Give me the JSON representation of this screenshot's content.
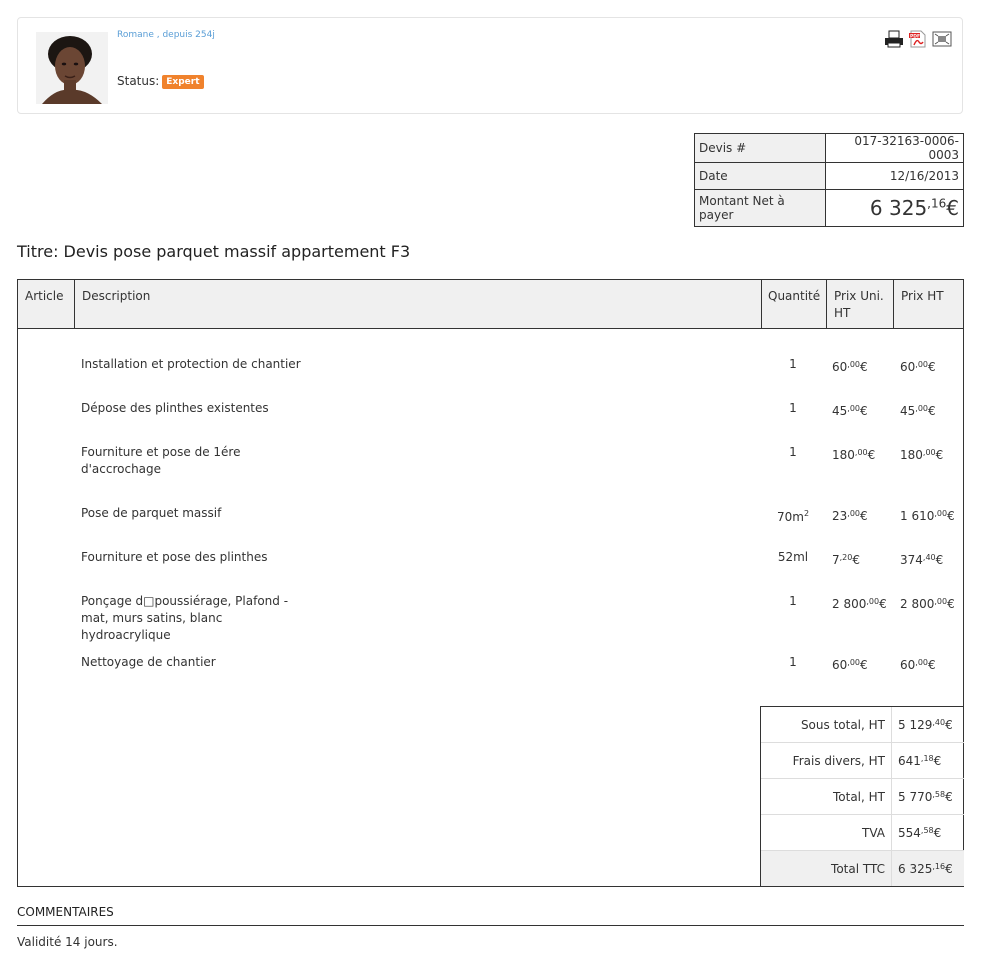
{
  "profile": {
    "seller": "Romane , depuis 254j",
    "status_label": "Status:",
    "status_badge": "Expert",
    "icons": [
      "printer-icon",
      "pdf-icon",
      "fullscreen-icon"
    ]
  },
  "meta": {
    "devis_label": "Devis #",
    "devis_value": "017-32163-0006-0003",
    "date_label": "Date",
    "date_value": "12/16/2013",
    "amount_label": "Montant Net à payer",
    "amount_main": "6 325",
    "amount_cents": ",16",
    "amount_currency": "€"
  },
  "title": "Titre: Devis pose parquet massif appartement F3",
  "table": {
    "headers": {
      "article": "Article",
      "description": "Description",
      "quantite": "Quantité",
      "prix_uni": "Prix Uni. HT",
      "prix_ht": "Prix HT"
    },
    "rows": [
      {
        "desc": "Installation et protection de chantier",
        "qty": "1",
        "pu": "60",
        "pu_c": ",00",
        "pt": "60",
        "pt_c": ",00"
      },
      {
        "desc": "Dépose des plinthes existentes",
        "qty": "1",
        "pu": "45",
        "pu_c": ",00",
        "pt": "45",
        "pt_c": ",00"
      },
      {
        "desc": "Fourniture et pose de 1ére d'accrochage",
        "qty": "1",
        "pu": "180",
        "pu_c": ",00",
        "pt": "180",
        "pt_c": ",00"
      },
      {
        "desc": "Pose de parquet massif",
        "qty": "70m",
        "qty_sup": "2",
        "pu": "23",
        "pu_c": ",00",
        "pt": "1 610",
        "pt_c": ",00"
      },
      {
        "desc": "Fourniture et pose des plinthes",
        "qty": "52ml",
        "pu": "7",
        "pu_c": ",20",
        "pt": "374",
        "pt_c": ",40"
      },
      {
        "desc": "Ponçage d□poussiérage, Plafond - mat, murs satins, blanc hydroacrylique",
        "qty": "1",
        "pu": "2 800",
        "pu_c": ",00",
        "pt": "2 800",
        "pt_c": ",00"
      },
      {
        "desc": "Nettoyage de chantier",
        "qty": "1",
        "pu": "60",
        "pu_c": ",00",
        "pt": "60",
        "pt_c": ",00"
      }
    ],
    "currency": "€"
  },
  "totals": [
    {
      "label": "Sous total, HT",
      "value": "5 129",
      "cents": ",40"
    },
    {
      "label": "Frais divers, HT",
      "value": "641",
      "cents": ",18"
    },
    {
      "label": "Total, HT",
      "value": "5 770",
      "cents": ",58"
    },
    {
      "label": "TVA",
      "value": "554",
      "cents": ",58"
    },
    {
      "label": "Total TTC",
      "value": "6 325",
      "cents": ",16"
    }
  ],
  "comments": {
    "title": "COMMENTAIRES",
    "text": "Validité 14 jours."
  }
}
